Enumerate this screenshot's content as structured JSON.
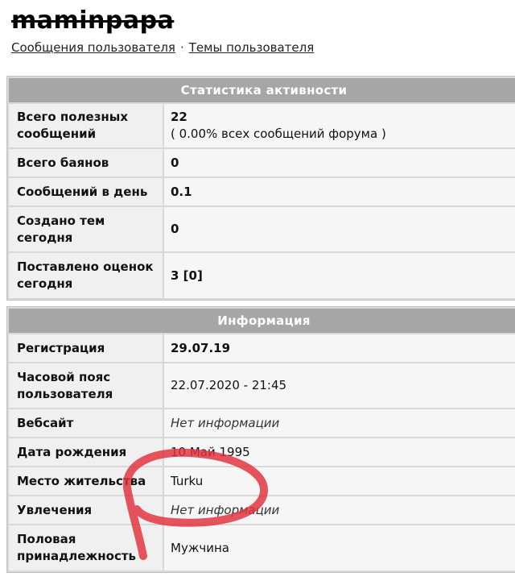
{
  "profile": {
    "username": "maminpapa",
    "links": [
      "Сообщения пользователя",
      "Темы пользователя"
    ],
    "separator": "·"
  },
  "activity": {
    "title": "Статистика активности",
    "rows": [
      {
        "label": "Всего полезных сообщений",
        "value": "22",
        "sub": "( 0.00% всех сообщений форума )"
      },
      {
        "label": "Всего баянов",
        "value": "0"
      },
      {
        "label": "Сообщений в день",
        "value": "0.1"
      },
      {
        "label": "Создано тем сегодня",
        "value": "0"
      },
      {
        "label": "Поставлено оценок сегодня",
        "value": "3 [0]"
      }
    ]
  },
  "info": {
    "title": "Информация",
    "rows": [
      {
        "label": "Регистрация",
        "value": "29.07.19"
      },
      {
        "label": "Часовой пояс пользователя",
        "value": "22.07.2020 - 21:45"
      },
      {
        "label": "Вебсайт",
        "value": "Нет информации"
      },
      {
        "label": "Дата рождения",
        "value": "10 Май 1995"
      },
      {
        "label": "Место жительства",
        "value": "Turku"
      },
      {
        "label": "Увлечения",
        "value": "Нет информации"
      },
      {
        "label": "Половая принадлежность",
        "value": "Мужчина"
      }
    ]
  },
  "colors": {
    "header_bg": "#a6a6a6",
    "annotation_red": "#e0303a"
  }
}
